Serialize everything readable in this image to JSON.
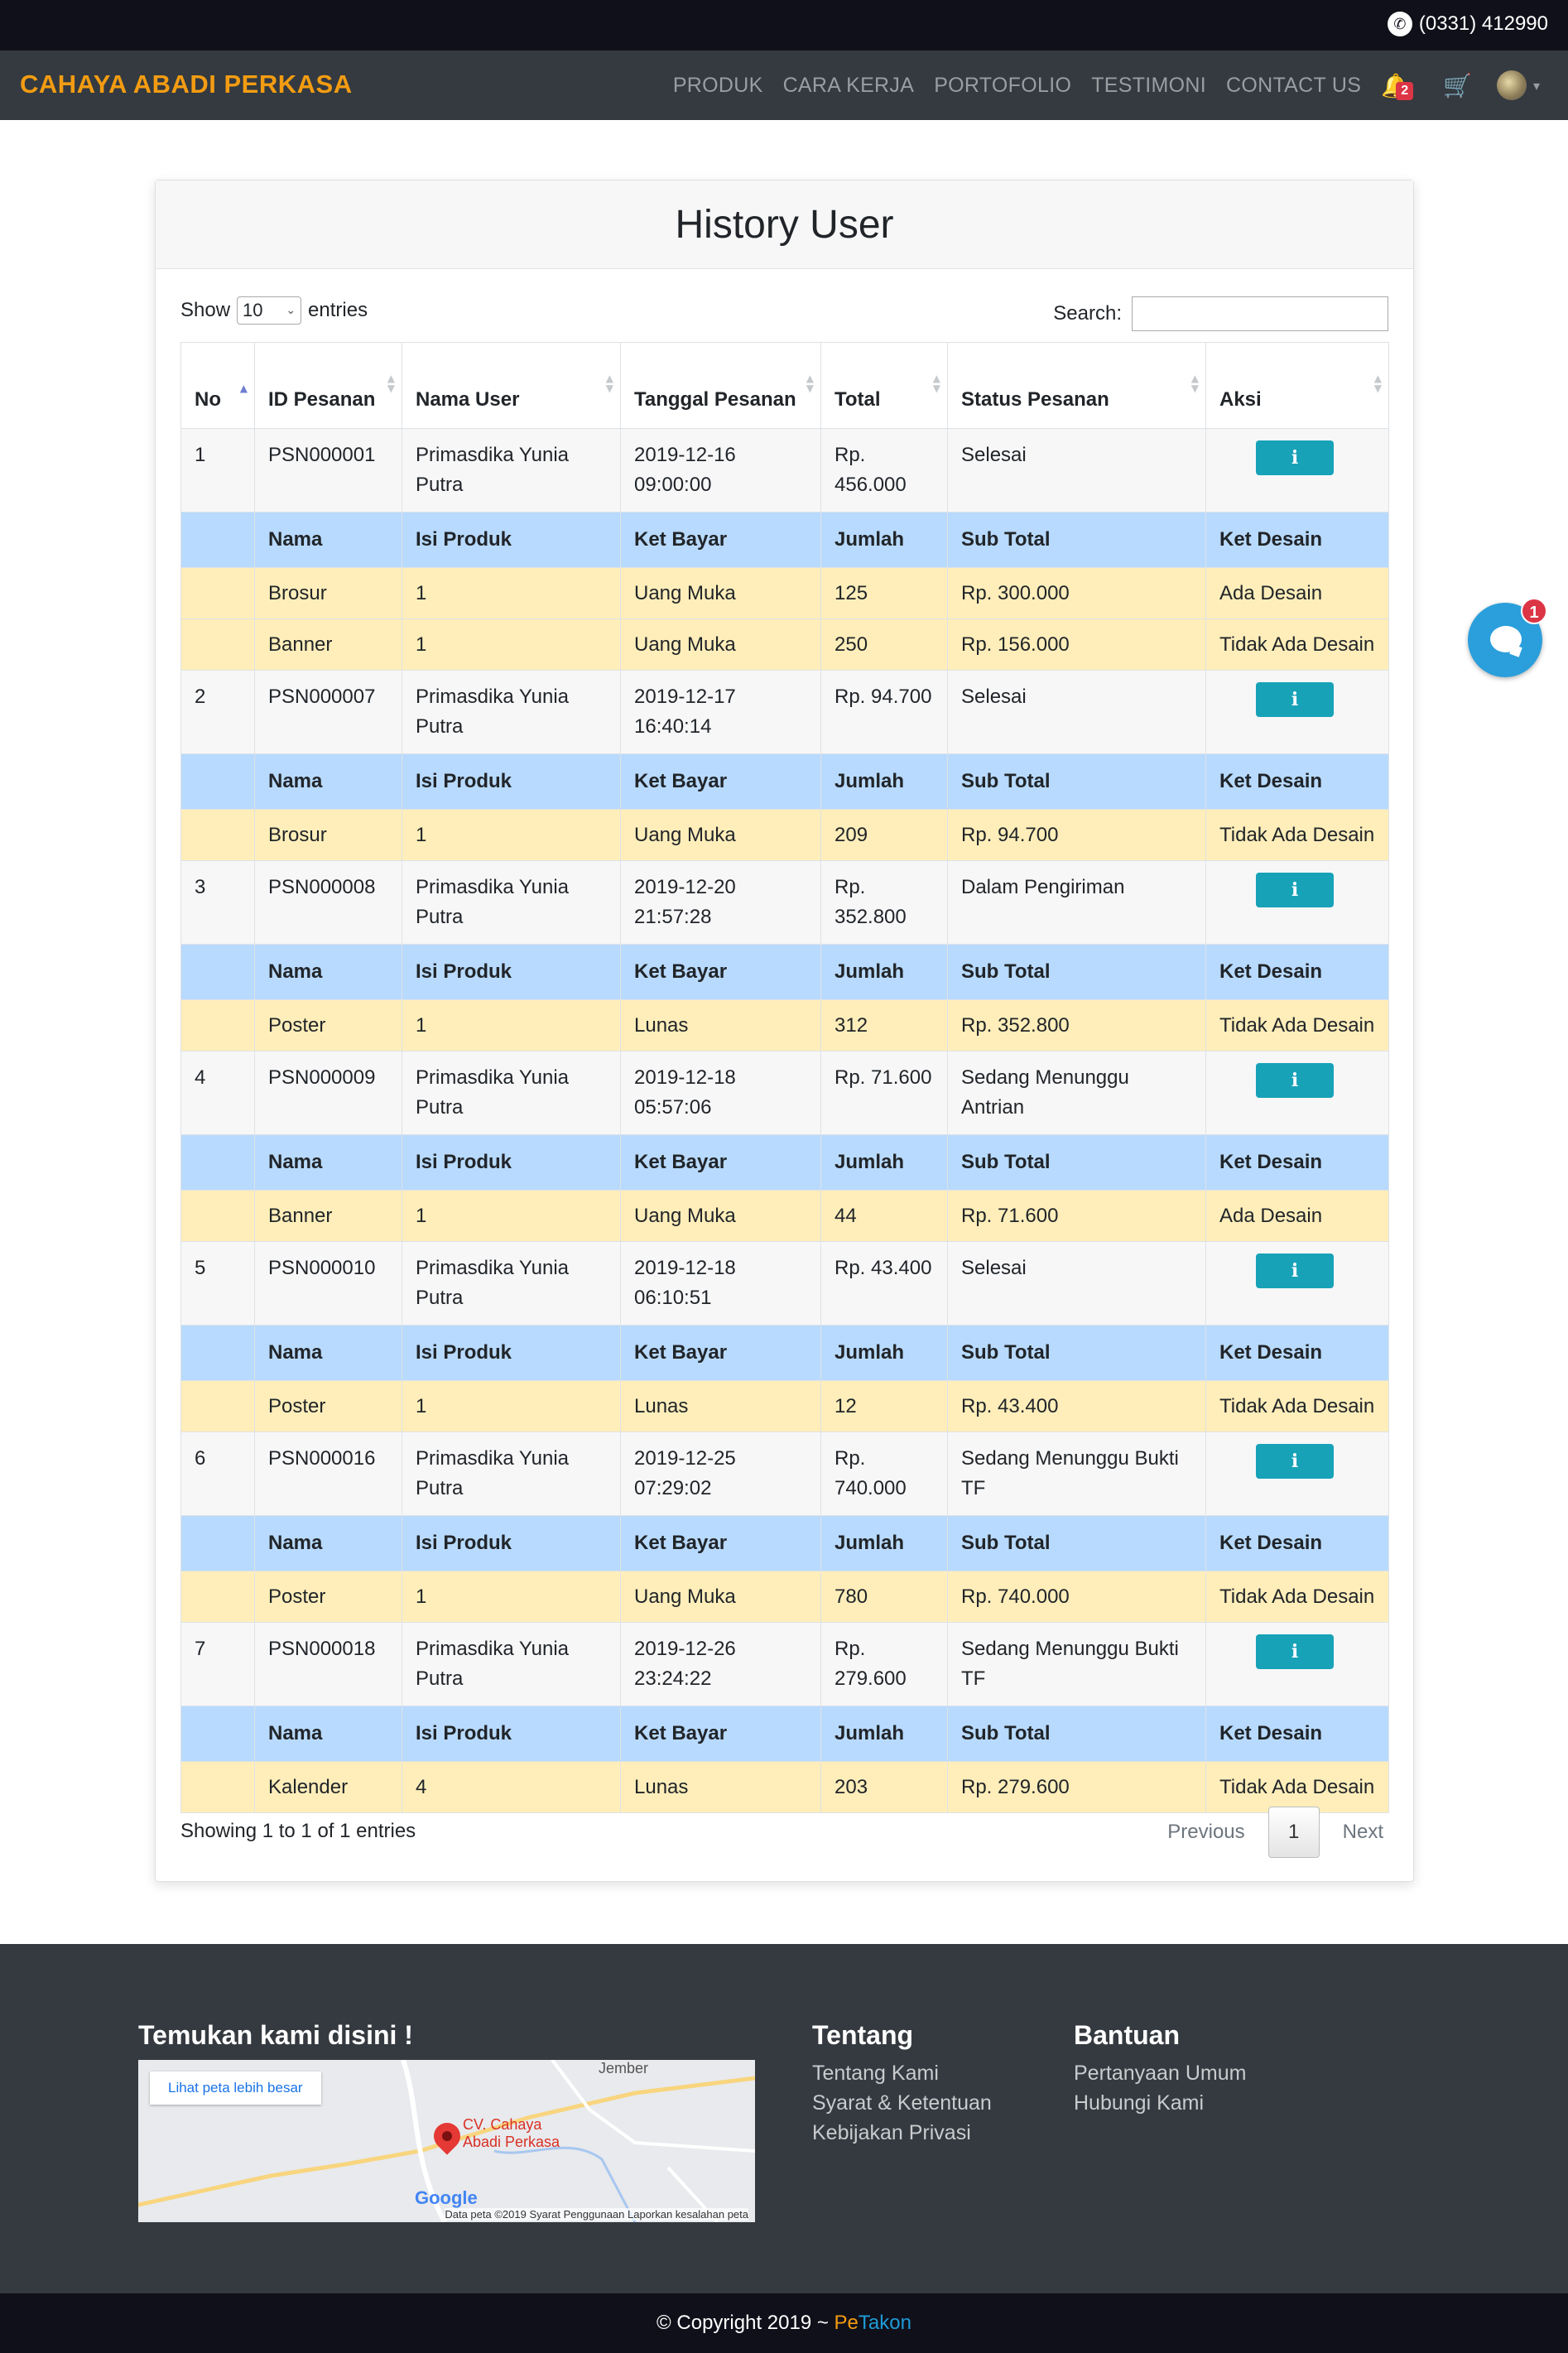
{
  "topbar": {
    "phone": "(0331) 412990"
  },
  "navbar": {
    "brand": "CAHAYA ABADI PERKASA",
    "links": [
      "PRODUK",
      "CARA KERJA",
      "PORTOFOLIO",
      "TESTIMONI",
      "CONTACT US"
    ],
    "notification_count": "2",
    "icons": [
      "bell-icon",
      "cart-icon",
      "avatar",
      "caret-down-icon"
    ]
  },
  "card": {
    "title": "History User",
    "show_label": "Show",
    "entries_value": "10",
    "entries_label": "entries",
    "search_label": "Search:",
    "search_value": "",
    "headers": [
      "No",
      "ID Pesanan",
      "Nama User",
      "Tanggal Pesanan",
      "Total",
      "Status Pesanan",
      "Aksi"
    ],
    "sub_headers": [
      "Nama",
      "Isi Produk",
      "Ket Bayar",
      "Jumlah",
      "Sub Total",
      "Ket Desain"
    ],
    "orders": [
      {
        "no": "1",
        "id": "PSN000001",
        "user": "Primasdika Yunia Putra",
        "date": "2019-12-16 09:00:00",
        "total": "Rp. 456.000",
        "status": "Selesai",
        "items": [
          {
            "nama": "Brosur",
            "isi": "1",
            "bayar": "Uang Muka",
            "jumlah": "125",
            "subtotal": "Rp. 300.000",
            "desain": "Ada Desain"
          },
          {
            "nama": "Banner",
            "isi": "1",
            "bayar": "Uang Muka",
            "jumlah": "250",
            "subtotal": "Rp. 156.000",
            "desain": "Tidak Ada Desain"
          }
        ]
      },
      {
        "no": "2",
        "id": "PSN000007",
        "user": "Primasdika Yunia Putra",
        "date": "2019-12-17 16:40:14",
        "total": "Rp. 94.700",
        "status": "Selesai",
        "items": [
          {
            "nama": "Brosur",
            "isi": "1",
            "bayar": "Uang Muka",
            "jumlah": "209",
            "subtotal": "Rp. 94.700",
            "desain": "Tidak Ada Desain"
          }
        ]
      },
      {
        "no": "3",
        "id": "PSN000008",
        "user": "Primasdika Yunia Putra",
        "date": "2019-12-20 21:57:28",
        "total": "Rp. 352.800",
        "status": "Dalam Pengiriman",
        "items": [
          {
            "nama": "Poster",
            "isi": "1",
            "bayar": "Lunas",
            "jumlah": "312",
            "subtotal": "Rp. 352.800",
            "desain": "Tidak Ada Desain"
          }
        ]
      },
      {
        "no": "4",
        "id": "PSN000009",
        "user": "Primasdika Yunia Putra",
        "date": "2019-12-18 05:57:06",
        "total": "Rp. 71.600",
        "status": "Sedang Menunggu Antrian",
        "items": [
          {
            "nama": "Banner",
            "isi": "1",
            "bayar": "Uang Muka",
            "jumlah": "44",
            "subtotal": "Rp. 71.600",
            "desain": "Ada Desain"
          }
        ]
      },
      {
        "no": "5",
        "id": "PSN000010",
        "user": "Primasdika Yunia Putra",
        "date": "2019-12-18 06:10:51",
        "total": "Rp. 43.400",
        "status": "Selesai",
        "items": [
          {
            "nama": "Poster",
            "isi": "1",
            "bayar": "Lunas",
            "jumlah": "12",
            "subtotal": "Rp. 43.400",
            "desain": "Tidak Ada Desain"
          }
        ]
      },
      {
        "no": "6",
        "id": "PSN000016",
        "user": "Primasdika Yunia Putra",
        "date": "2019-12-25 07:29:02",
        "total": "Rp. 740.000",
        "status": "Sedang Menunggu Bukti TF",
        "items": [
          {
            "nama": "Poster",
            "isi": "1",
            "bayar": "Uang Muka",
            "jumlah": "780",
            "subtotal": "Rp. 740.000",
            "desain": "Tidak Ada Desain"
          }
        ]
      },
      {
        "no": "7",
        "id": "PSN000018",
        "user": "Primasdika Yunia Putra",
        "date": "2019-12-26 23:24:22",
        "total": "Rp. 279.600",
        "status": "Sedang Menunggu Bukti TF",
        "items": [
          {
            "nama": "Kalender",
            "isi": "4",
            "bayar": "Lunas",
            "jumlah": "203",
            "subtotal": "Rp. 279.600",
            "desain": "Tidak Ada Desain"
          }
        ]
      }
    ],
    "action_icon": "info-icon",
    "info_text": "Showing 1 to 1 of 1 entries",
    "pagination": {
      "previous": "Previous",
      "page": "1",
      "next": "Next"
    }
  },
  "chat": {
    "badge": "1"
  },
  "footer": {
    "find_us_title": "Temukan kami disini !",
    "map": {
      "link": "Lihat peta lebih besar",
      "place": "CV. Cahaya Abadi Perkasa",
      "town": "Jember",
      "brand": "Google",
      "attribution": "Data peta ©2019    Syarat Penggunaan    Laporkan kesalahan peta"
    },
    "about_title": "Tentang",
    "about_links": [
      "Tentang Kami",
      "Syarat & Ketentuan",
      "Kebijakan Privasi"
    ],
    "help_title": "Bantuan",
    "help_links": [
      "Pertanyaan Umum",
      "Hubungi Kami"
    ]
  },
  "copyright": {
    "text": "© Copyright 2019 ~ ",
    "pe": "Pe",
    "takon": "Takon"
  },
  "colors": {
    "brand": "#f39c12",
    "navbar_bg": "#343a40",
    "topbar_bg": "#10101a",
    "sub_header_bg": "#b8daff",
    "item_row_bg": "#ffeeba",
    "info_button": "#17a2b8",
    "chat_button": "#2b9fdc"
  }
}
